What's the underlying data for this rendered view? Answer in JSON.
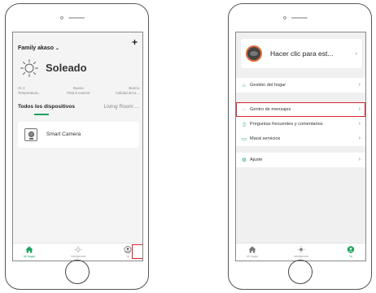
{
  "left_phone": {
    "home_name": "Family akaso",
    "home_chevron": "⌄",
    "add_icon": "+",
    "weather": {
      "icon": "sun-icon",
      "label": "Soleado",
      "stats": [
        {
          "value": "21 C",
          "label": "Temperatura..."
        },
        {
          "value": "Bueno",
          "label": "PM2.5 exterior"
        },
        {
          "value": "Bueno",
          "label": "Calidad del a..."
        }
      ]
    },
    "tabs": {
      "all": "Todos los dispositivos",
      "room": "Living Room ..."
    },
    "device": {
      "name": "Smart Camera",
      "icon": "camera-icon"
    },
    "nav": [
      {
        "label": "Mi hogar",
        "icon": "home-icon"
      },
      {
        "label": "Inteligencia",
        "icon": "smart-icon"
      },
      {
        "label": "Yo",
        "icon": "profile-icon"
      }
    ]
  },
  "right_phone": {
    "profile_name": "Hacer clic para est...",
    "menu_groups": [
      [
        {
          "label": "Gestión del hogar",
          "icon": "house-icon"
        }
      ],
      [
        {
          "label": "Gentro de mensajes",
          "icon": "message-icon",
          "highlighted": true
        },
        {
          "label": "Preguntas frecuentes y comentarios",
          "icon": "book-icon"
        },
        {
          "label": "Maoá servicios",
          "icon": "bookmark-icon"
        }
      ],
      [
        {
          "label": "Ajuste",
          "icon": "gear-icon"
        }
      ]
    ],
    "nav": [
      {
        "label": "Mi hogar",
        "icon": "home-icon"
      },
      {
        "label": "Inteligencia",
        "icon": "smart-icon"
      },
      {
        "label": "Yo",
        "icon": "profile-icon"
      }
    ]
  },
  "colors": {
    "accent": "#1aa35f",
    "highlight": "#d9232d"
  }
}
